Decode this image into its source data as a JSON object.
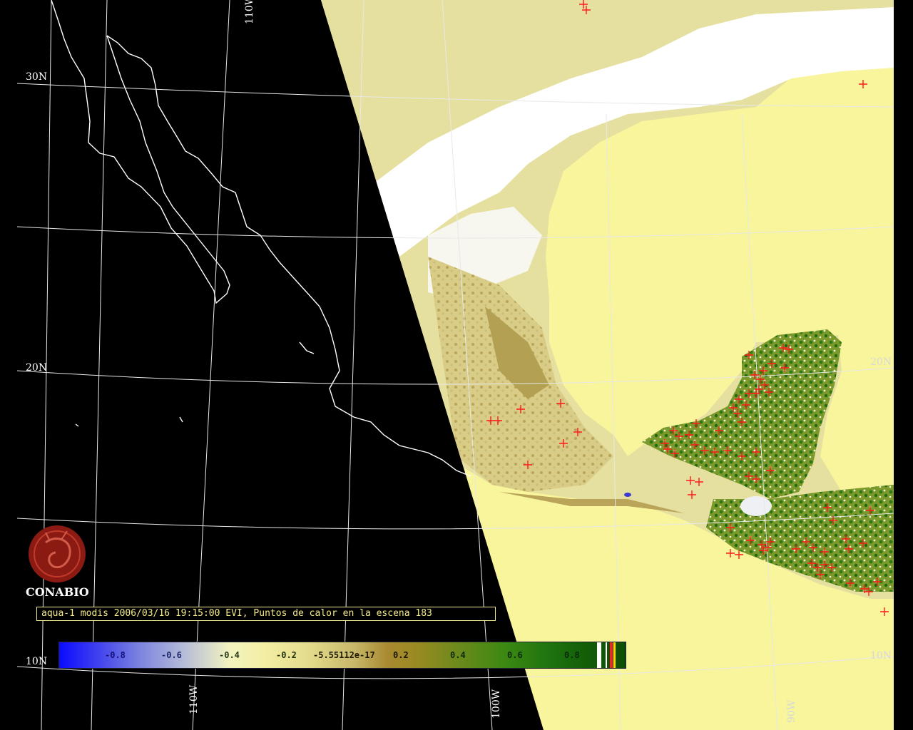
{
  "caption": "aqua-1 modis 2006/03/16 19:15:00 EVI, Puntos de calor en la escena 183",
  "logo": {
    "text": "CONABIO",
    "color": "#8b1a12"
  },
  "graticule": {
    "lat_labels": [
      "30N",
      "20N",
      "10N"
    ],
    "lon_labels": [
      "110W",
      "110W",
      "100W",
      "20N",
      "10N",
      "90W"
    ]
  },
  "colorbar": {
    "ticks": [
      "-0.8",
      "-0.6",
      "-0.4",
      "-0.2",
      "-5.55112e-17",
      "0.2",
      "0.4",
      "0.6",
      "0.8"
    ],
    "tick_colors": [
      "#12127a",
      "#1c2a6a",
      "#2a3a1a",
      "#20300a",
      "#201a00",
      "#1c1400",
      "#0a2a08",
      "#0a2a08",
      "#0a2a08"
    ]
  },
  "colors": {
    "land_low": "#f2ee9e",
    "land_mid": "#c2b06a",
    "vegetation": "#1f7a12",
    "ocean_scene": "#f8f59c",
    "outside_scene": "#000000",
    "coastline": "#ffffff",
    "fire_point": "#ff1a1a"
  }
}
